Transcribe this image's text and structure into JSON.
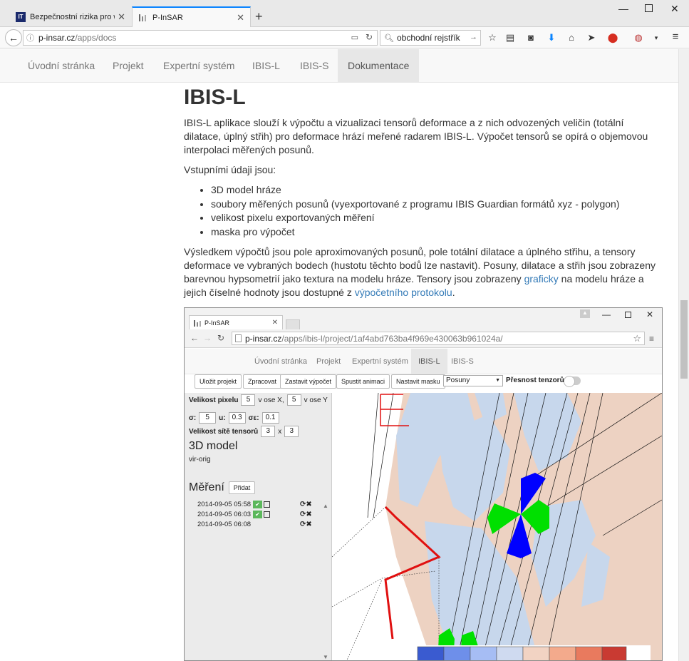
{
  "browser": {
    "tabs": [
      {
        "title": "Bezpečnostní rizika pro we...",
        "favicon": "IT"
      },
      {
        "title": "P-InSAR"
      }
    ],
    "url_host": "p-insar.cz",
    "url_path": "/apps/docs",
    "search_text": "obchodní rejstřík"
  },
  "site_nav": {
    "items": [
      "Úvodní stránka",
      "Projekt",
      "Expertní systém",
      "IBIS-L",
      "IBIS-S",
      "Dokumentace"
    ]
  },
  "content": {
    "title": "IBIS-L",
    "p1": "IBIS-L aplikace slouží k výpočtu a vizualizaci tensorů deformace a z nich odvozených veličin (totální dilatace, úplný střih) pro deformace hrází meřené radarem IBIS-L. Výpočet tensorů se opírá o objemovou interpolaci měřených posunů.",
    "p2": "Vstupními údaji jsou:",
    "list": [
      "3D model hráze",
      "soubory měřených posunů (vyexportované z programu IBIS Guardian formátů xyz - polygon)",
      "velikost pixelu exportovaných měření",
      "maska pro výpočet"
    ],
    "p3_before": "Výsledkem výpočtů jsou pole aproximovaných posunů, pole totální dilatace a úplného střihu, a tensory deformace ve vybraných bodech (hustotu těchto bodů lze nastavit). Posuny, dilatace a střih jsou zobrazeny barevnou hypsometrií jako textura na modelu hráze. Tensory jsou zobrazeny ",
    "p3_link1": "graficky",
    "p3_middle": " na modelu hráze a jejich číselné hodnoty jsou dostupné z ",
    "p3_link2": "výpočetního protokolu",
    "p3_after": "."
  },
  "inner": {
    "tab_title": "P-InSAR",
    "url_host": "p-insar.cz",
    "url_path": "/apps/ibis-l/project/1af4abd763ba4f969e430063b961024a/",
    "nav_items": [
      "Úvodní stránka",
      "Projekt",
      "Expertní systém",
      "IBIS-L",
      "IBIS-S"
    ],
    "buttons": [
      "Uložit projekt",
      "Zpracovat",
      "Zastavit výpočet",
      "Spustit animaci",
      "Nastavit masku"
    ],
    "select_value": "Posuny",
    "precision_label": "Přesnost tenzorů",
    "pixel_label": "Velikost pixelu",
    "pixel_x": "5",
    "axis_x_label": "v ose X,",
    "pixel_y": "5",
    "axis_y_label": "v ose Y",
    "sigma_label": "σ:",
    "sigma_value": "5",
    "u_label": "u:",
    "u_value": "0.3",
    "sigma_eps_label": "σε:",
    "sigma_eps_value": "0.1",
    "grid_label": "Velikost sítě tensorů",
    "grid_x": "3",
    "grid_times": "x",
    "grid_y": "3",
    "model_heading": "3D model",
    "model_name": "vir-orig",
    "measure_heading": "Měření",
    "add_button": "Přidat",
    "measurements": [
      {
        "date": "2014-09-05 05:58",
        "checked": true
      },
      {
        "date": "2014-09-05 06:03",
        "checked": true
      },
      {
        "date": "2014-09-05 06:08",
        "checked": false
      }
    ],
    "colors": {
      "salmon": "#edd2c2",
      "blue_light": "#c7d7ec",
      "tensor_blue": "#0000ff",
      "tensor_green": "#00e000",
      "red_line": "#e01010",
      "scale": [
        "#3a5bd0",
        "#6e8fea",
        "#a6bdf4",
        "#cfdaf0",
        "#f2d3c3",
        "#f3aa8c",
        "#e97a5e",
        "#c93a32"
      ]
    }
  }
}
